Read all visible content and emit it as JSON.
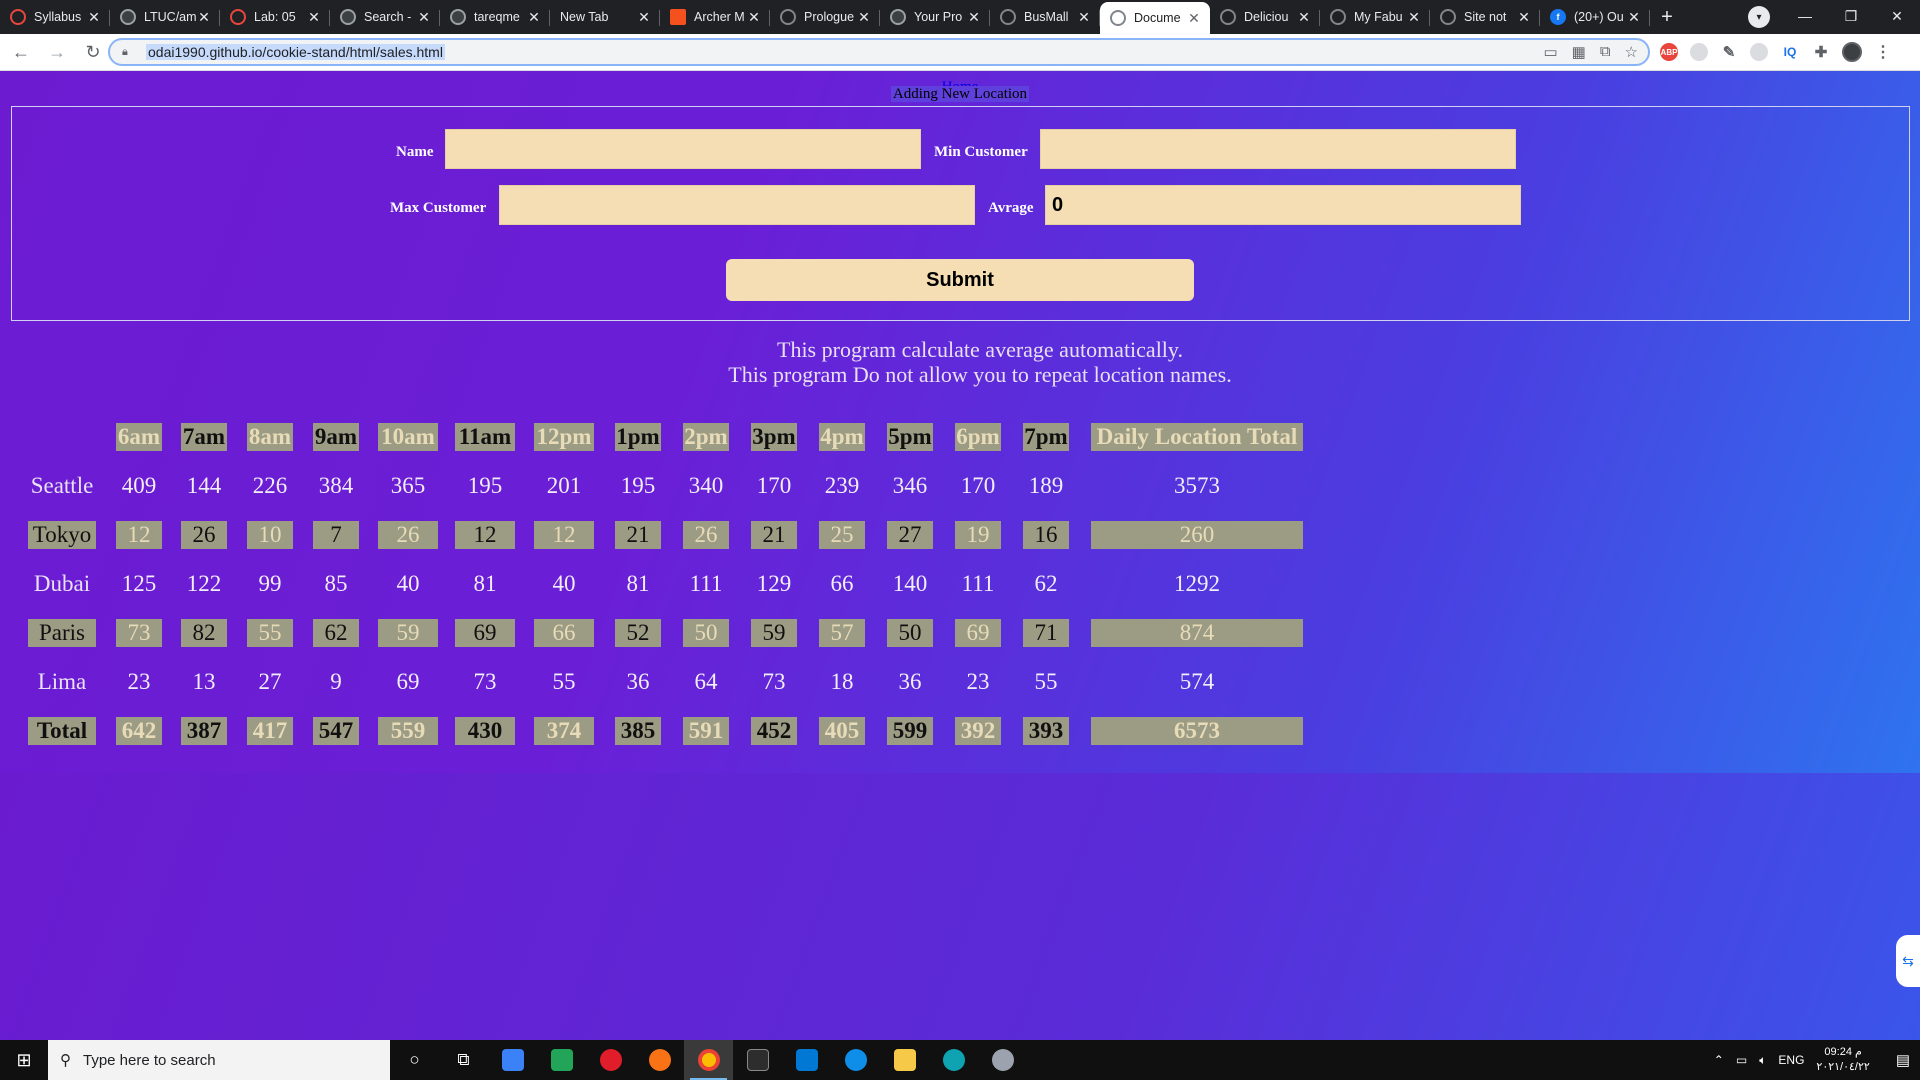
{
  "browser": {
    "tabs": [
      {
        "title": "Syllabus",
        "favicon": "red-circle-icon"
      },
      {
        "title": "LTUC/am",
        "favicon": "github-icon"
      },
      {
        "title": "Lab: 05",
        "favicon": "red-circle-icon"
      },
      {
        "title": "Search -",
        "favicon": "github-icon"
      },
      {
        "title": "tareqme",
        "favicon": "github-icon"
      },
      {
        "title": "New Tab",
        "favicon": "none"
      },
      {
        "title": "Archer M",
        "favicon": "orange-square-icon"
      },
      {
        "title": "Prologue",
        "favicon": "globe-icon"
      },
      {
        "title": "Your Pro",
        "favicon": "github-icon"
      },
      {
        "title": "BusMall",
        "favicon": "globe-icon"
      },
      {
        "title": "Docume",
        "favicon": "globe-icon",
        "active": true
      },
      {
        "title": "Deliciou",
        "favicon": "globe-icon"
      },
      {
        "title": "My Fabu",
        "favicon": "globe-icon"
      },
      {
        "title": "Site not",
        "favicon": "globe-icon"
      },
      {
        "title": "(20+) Ou",
        "favicon": "facebook-icon"
      }
    ],
    "url": "odai1990.github.io/cookie-stand/html/sales.html",
    "extensions": [
      "ABP",
      "IQ"
    ]
  },
  "page": {
    "home_link": "Home",
    "legend": "Adding New Location",
    "form": {
      "name_label": "Name",
      "name_value": "",
      "min_label": "Min Customer",
      "min_value": "",
      "max_label": "Max Customer",
      "max_value": "",
      "avg_label": "Avrage",
      "avg_value": "0",
      "submit_label": "Submit"
    },
    "info_line_1": "This program calculate average automatically.",
    "info_line_2": "This program Do not allow you to repeat location names."
  },
  "sales_table": {
    "hours": [
      "6am",
      "7am",
      "8am",
      "9am",
      "10am",
      "11am",
      "12pm",
      "1pm",
      "2pm",
      "3pm",
      "4pm",
      "5pm",
      "6pm",
      "7pm"
    ],
    "total_header": "Daily Location Total",
    "rows": [
      {
        "name": "Seattle",
        "values": [
          "409",
          "144",
          "226",
          "384",
          "365",
          "195",
          "201",
          "195",
          "340",
          "170",
          "239",
          "346",
          "170",
          "189"
        ],
        "total": "3573"
      },
      {
        "name": "Tokyo",
        "values": [
          "12",
          "26",
          "10",
          "7",
          "26",
          "12",
          "12",
          "21",
          "26",
          "21",
          "25",
          "27",
          "19",
          "16"
        ],
        "total": "260"
      },
      {
        "name": "Dubai",
        "values": [
          "125",
          "122",
          "99",
          "85",
          "40",
          "81",
          "40",
          "81",
          "111",
          "129",
          "66",
          "140",
          "111",
          "62"
        ],
        "total": "1292"
      },
      {
        "name": "Paris",
        "values": [
          "73",
          "82",
          "55",
          "62",
          "59",
          "69",
          "66",
          "52",
          "50",
          "59",
          "57",
          "50",
          "69",
          "71"
        ],
        "total": "874"
      },
      {
        "name": "Lima",
        "values": [
          "23",
          "13",
          "27",
          "9",
          "69",
          "73",
          "55",
          "36",
          "64",
          "73",
          "18",
          "36",
          "23",
          "55"
        ],
        "total": "574"
      }
    ],
    "footer": {
      "label": "Total",
      "values": [
        "642",
        "387",
        "417",
        "547",
        "559",
        "430",
        "374",
        "385",
        "591",
        "452",
        "405",
        "599",
        "392",
        "393"
      ],
      "total": "6573"
    },
    "colors": {
      "shade": "#9c9c85",
      "light_text": "#e8dbb8",
      "dark_text": "#101010"
    }
  },
  "taskbar": {
    "search_placeholder": "Type here to search",
    "language": "ENG",
    "time": "09:24 م",
    "date": "٢٠٢١/٠٤/٢٢"
  }
}
